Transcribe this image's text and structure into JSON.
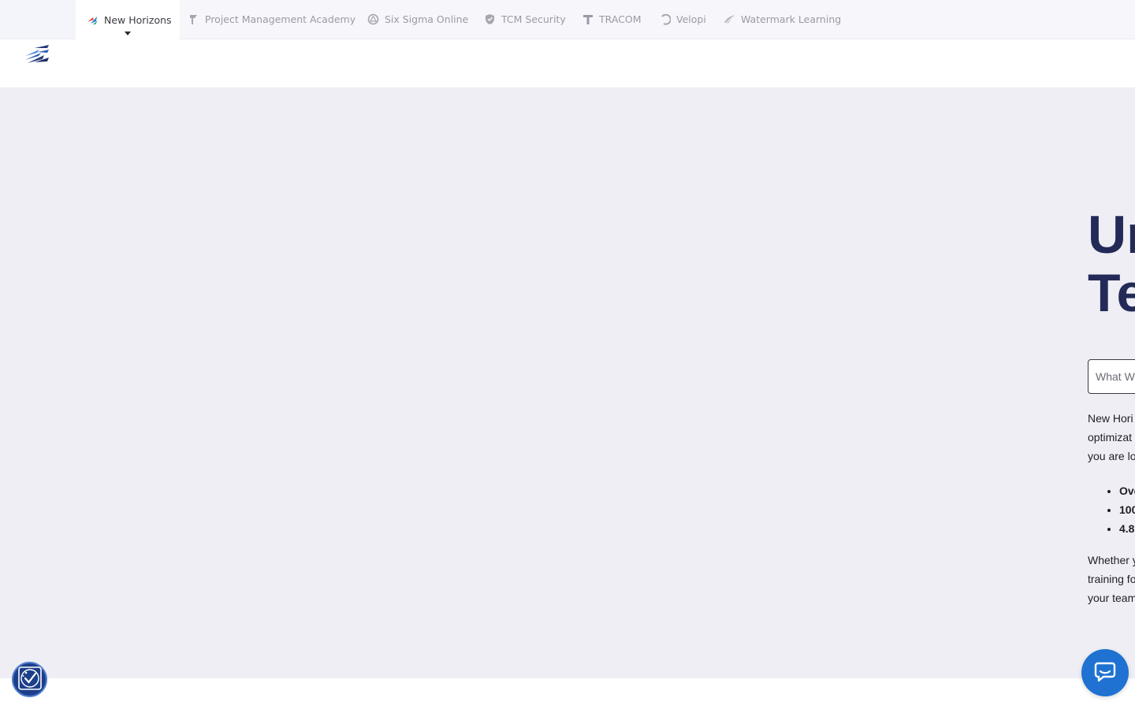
{
  "brand_bar": {
    "tabs": [
      {
        "label": "New Horizons",
        "icon": "new-horizons-logo-icon",
        "active": true
      },
      {
        "label": "Project Management Academy",
        "icon": "pma-logo-icon"
      },
      {
        "label": "Six Sigma Online",
        "icon": "six-sigma-logo-icon"
      },
      {
        "label": "TCM Security",
        "icon": "tcm-shield-icon"
      },
      {
        "label": "TRACOM",
        "icon": "tracom-t-icon"
      },
      {
        "label": "Velopi",
        "icon": "velopi-logo-icon"
      },
      {
        "label": "Watermark Learning",
        "icon": "watermark-logo-icon"
      }
    ]
  },
  "header": {
    "logo": "new-horizons-logo"
  },
  "hero": {
    "title_lines": [
      "Ur",
      "Te"
    ],
    "search_placeholder": "What W",
    "intro_lines": [
      "New Hori",
      "optimizat",
      "you are lo"
    ],
    "bullets": [
      "Ove",
      "100",
      "4.8"
    ],
    "closing_lines": [
      "Whether y",
      "training fo",
      "your team"
    ]
  },
  "widgets": {
    "accessibility": "accessibility-icon",
    "chat": "chat-icon"
  },
  "colors": {
    "hero_bg": "#eeeef4",
    "title": "#232a57",
    "chat": "#1f72d2",
    "accessibility": "#1d3f8a"
  }
}
